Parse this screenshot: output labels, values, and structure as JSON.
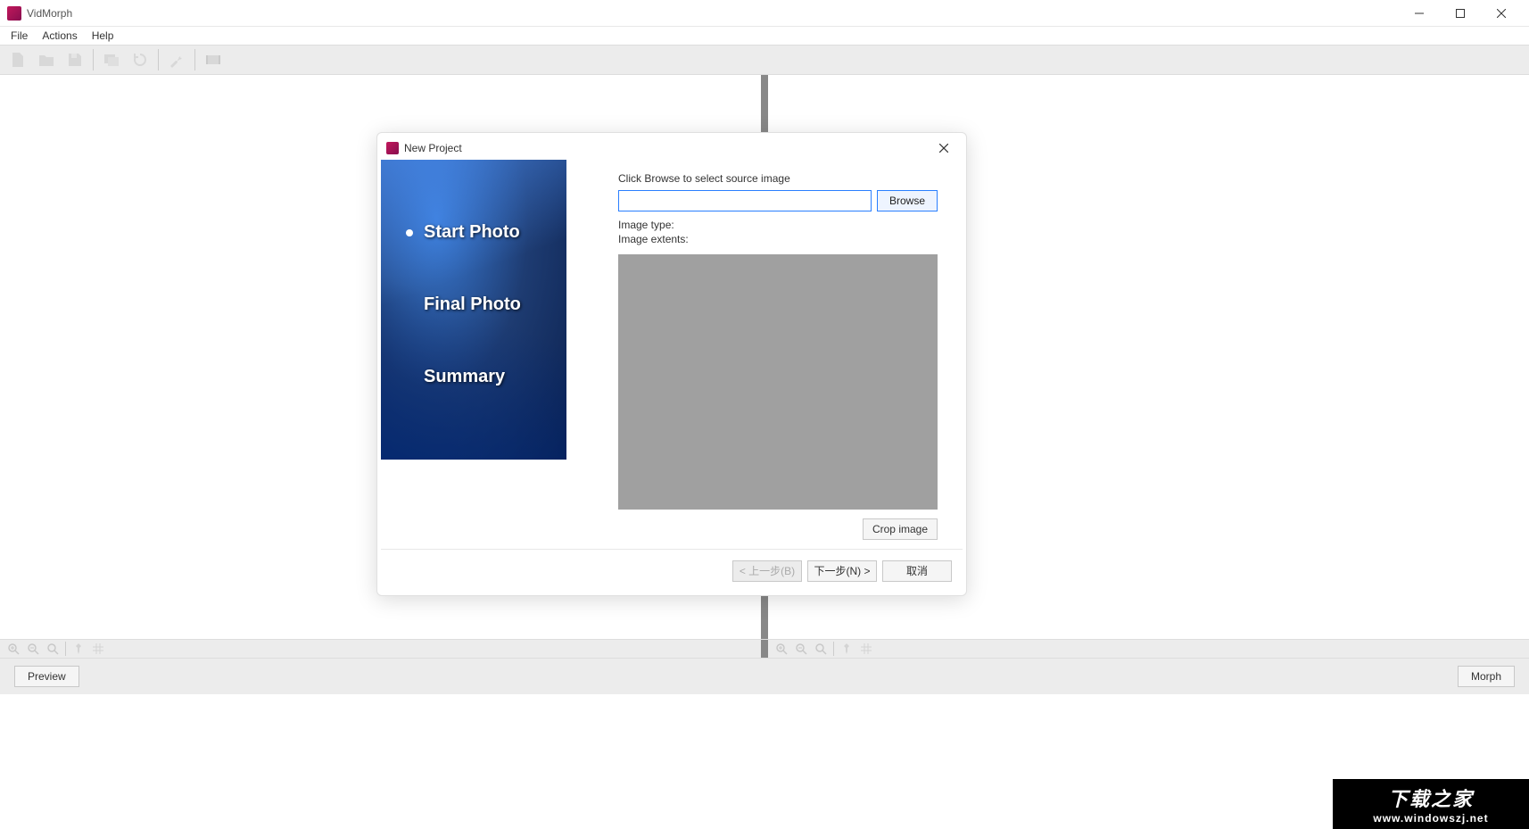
{
  "app": {
    "title": "VidMorph"
  },
  "menu": {
    "file": "File",
    "actions": "Actions",
    "help": "Help"
  },
  "bottom": {
    "preview": "Preview",
    "morph": "Morph"
  },
  "dialog": {
    "title": "New Project",
    "steps": {
      "start": "Start Photo",
      "final": "Final Photo",
      "summary": "Summary"
    },
    "instruction": "Click Browse to select source image",
    "browse": "Browse",
    "image_type_label": "Image type:",
    "image_extents_label": "Image extents:",
    "crop": "Crop image",
    "back": "< 上一步(B)",
    "next": "下一步(N) >",
    "cancel": "取消",
    "path_value": ""
  },
  "watermark": {
    "main": "下载之家",
    "sub": "www.windowszj.net"
  }
}
